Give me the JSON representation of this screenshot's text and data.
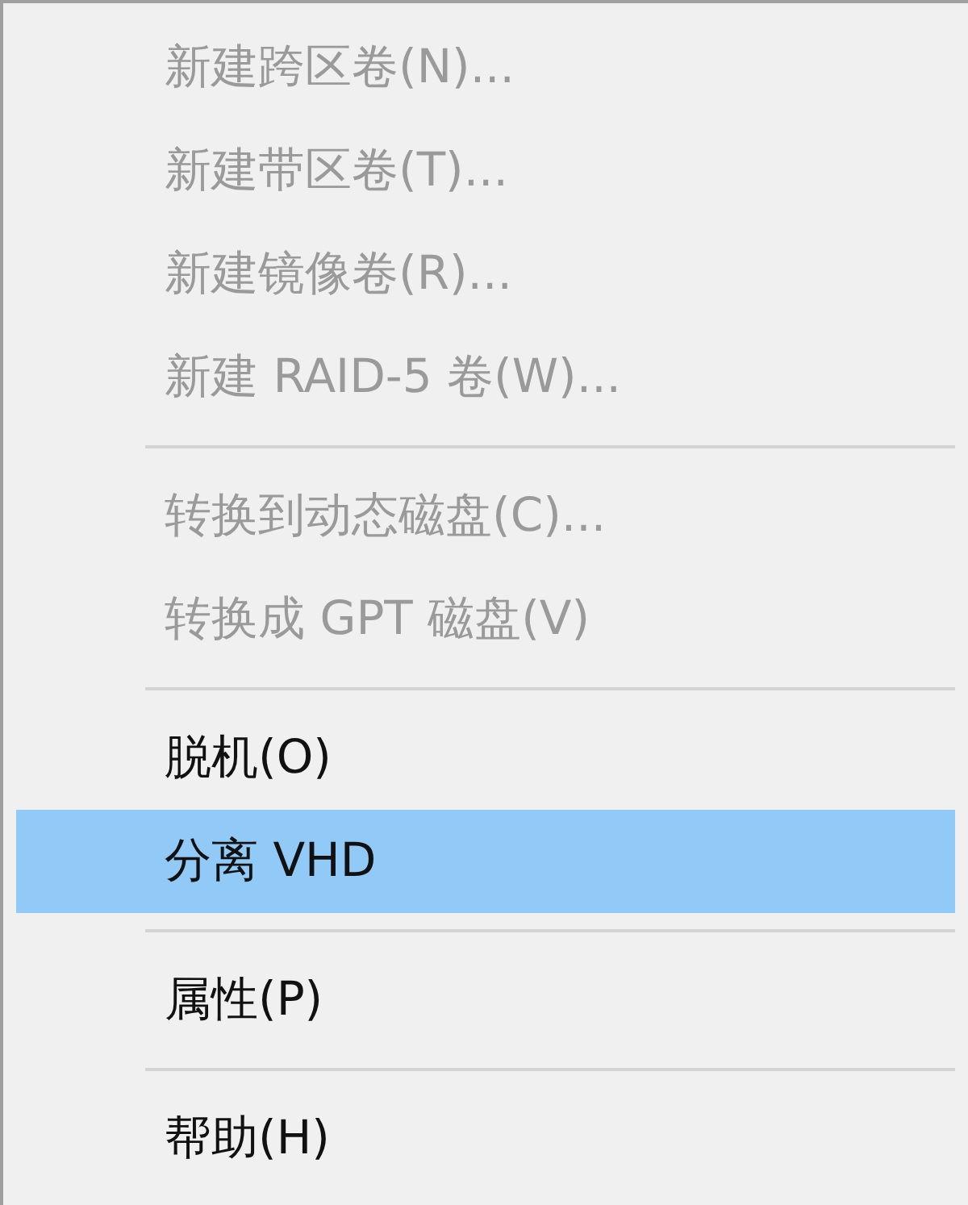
{
  "menu": {
    "items": [
      {
        "kind": "item",
        "label": "新建跨区卷(N)...",
        "disabled": true,
        "selected": false
      },
      {
        "kind": "item",
        "label": "新建带区卷(T)...",
        "disabled": true,
        "selected": false
      },
      {
        "kind": "item",
        "label": "新建镜像卷(R)...",
        "disabled": true,
        "selected": false
      },
      {
        "kind": "item",
        "label": "新建 RAID-5 卷(W)...",
        "disabled": true,
        "selected": false
      },
      {
        "kind": "separator"
      },
      {
        "kind": "item",
        "label": "转换到动态磁盘(C)...",
        "disabled": true,
        "selected": false
      },
      {
        "kind": "item",
        "label": "转换成 GPT 磁盘(V)",
        "disabled": true,
        "selected": false
      },
      {
        "kind": "separator"
      },
      {
        "kind": "item",
        "label": "脱机(O)",
        "disabled": false,
        "selected": false
      },
      {
        "kind": "item",
        "label": "分离 VHD",
        "disabled": false,
        "selected": true
      },
      {
        "kind": "separator"
      },
      {
        "kind": "item",
        "label": "属性(P)",
        "disabled": false,
        "selected": false
      },
      {
        "kind": "separator"
      },
      {
        "kind": "item",
        "label": "帮助(H)",
        "disabled": false,
        "selected": false
      }
    ]
  }
}
